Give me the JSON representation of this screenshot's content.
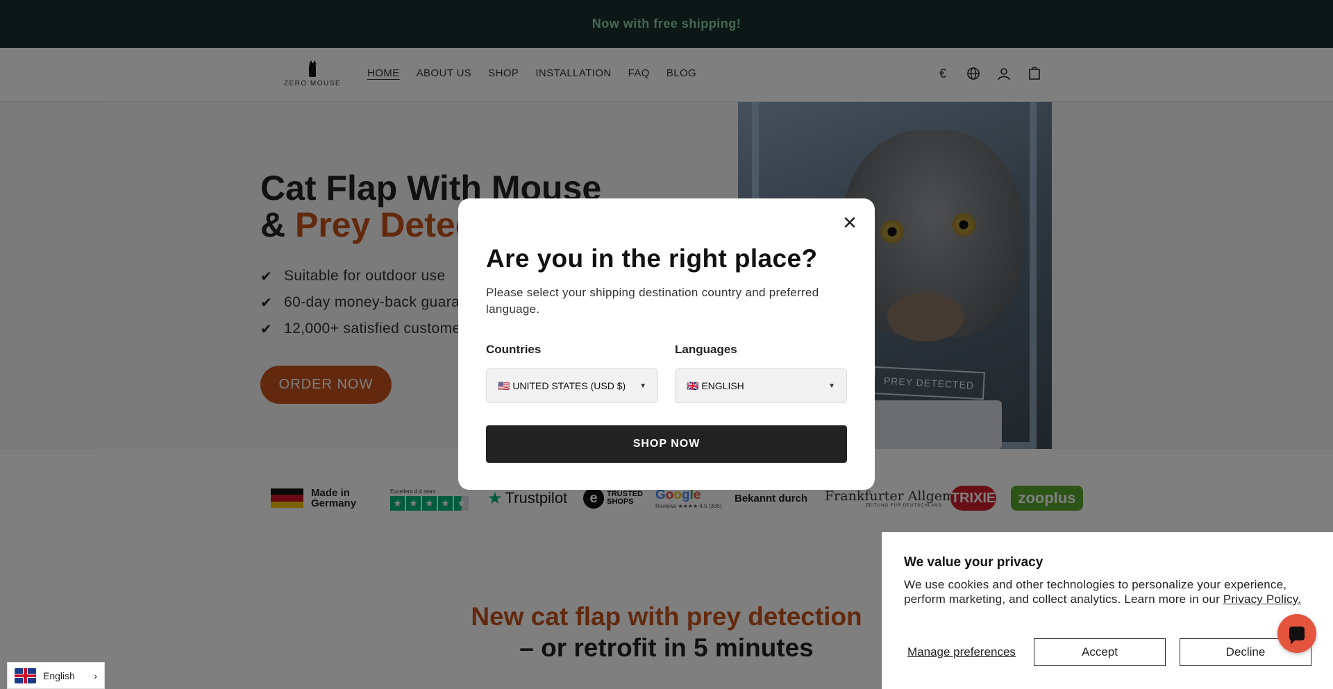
{
  "announcement": "Now with free shipping!",
  "header": {
    "logo_text": "ZERO MOUSE",
    "nav": [
      {
        "label": "HOME"
      },
      {
        "label": "ABOUT US"
      },
      {
        "label": "SHOP"
      },
      {
        "label": "INSTALLATION"
      },
      {
        "label": "FAQ"
      },
      {
        "label": "BLOG"
      }
    ],
    "currency_symbol": "€",
    "icons": [
      "currency-icon",
      "globe-icon",
      "account-icon",
      "cart-icon"
    ]
  },
  "hero": {
    "title_line1": "Cat Flap With Mouse",
    "title_amp": "& ",
    "title_accent": "Prey Detection",
    "bullets": [
      "Suitable for outdoor use",
      "60-day money-back guarantee",
      "12,000+ satisfied customers"
    ],
    "cta": "ORDER NOW",
    "image_tag": "PREY DETECTED"
  },
  "trust": {
    "made_in_line1": "Made in",
    "made_in_line2": "Germany",
    "trustpilot_caption": "Excellent 4.4 stars",
    "trustpilot_name": "Trustpilot",
    "trusted_shops_line1": "TRUSTED",
    "trusted_shops_line2": "SHOPS",
    "google_word": "Google",
    "google_sub": "Reviews ★★★★ 4.5 (306)",
    "bekannt": "Bekannt durch",
    "faz_name": "Frankfurter Allgemeine",
    "faz_sub": "ZEITUNG FÜR DEUTSCHLAND",
    "trixie": "TRIXIE",
    "zooplus": "zooplus"
  },
  "section": {
    "heading_line1": "New cat flap with prey detection",
    "heading_line2": "– or retrofit in 5 minutes"
  },
  "modal": {
    "title": "Are you in the right place?",
    "description": "Please select your shipping destination country and preferred language.",
    "countries_label": "Countries",
    "country_value": "🇺🇸 UNITED STATES (USD $)",
    "languages_label": "Languages",
    "language_value": "🇬🇧 ENGLISH",
    "submit": "SHOP NOW"
  },
  "cookie": {
    "title": "We value your privacy",
    "text": "We use cookies and other technologies to personalize your experience, perform marketing, and collect analytics. Learn more in our ",
    "link": "Privacy Policy.",
    "manage": "Manage preferences",
    "accept": "Accept",
    "decline": "Decline"
  },
  "language_switcher": {
    "label": "English"
  },
  "colors": {
    "announcement_bg": "#17312a",
    "accent": "#c5521c",
    "trustpilot_green": "#00b67a",
    "chat_bubble": "#e5543d"
  }
}
